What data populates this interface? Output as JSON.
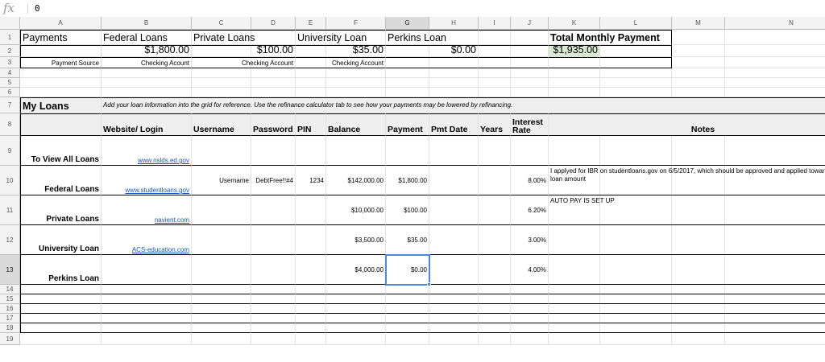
{
  "formula_bar": {
    "fx_label": "fx",
    "value": "0"
  },
  "columns": [
    "A",
    "B",
    "C",
    "D",
    "E",
    "F",
    "G",
    "H",
    "I",
    "J",
    "K",
    "L",
    "M",
    "N"
  ],
  "rows": [
    "1",
    "2",
    "3",
    "4",
    "5",
    "6",
    "7",
    "8",
    "9",
    "10",
    "11",
    "12",
    "13",
    "14",
    "15",
    "16",
    "17",
    "18",
    "19"
  ],
  "selected": {
    "column": "G",
    "row": "13"
  },
  "payments": {
    "title": "Payments",
    "headers": [
      "Federal Loans",
      "Private Loans",
      "University Loan",
      "Perkins Loan"
    ],
    "amounts": [
      "$1,800.00",
      "$100.00",
      "$35.00",
      "$0.00"
    ],
    "source_label": "Payment Source",
    "sources": [
      "Checking Acount",
      "Checking Account",
      "Checking Account"
    ],
    "total_label": "Total Monthly Payment",
    "total_value": "$1,935.00",
    "total_bg": "#d9ead3"
  },
  "my_loans": {
    "title": "My Loans",
    "note": "Add your loan information into the grid for reference.  Use the refinance calculator tab to see how your payments may be lowered by refinancing.",
    "headers": [
      "Website/ Login",
      "Username",
      "Password",
      "PIN",
      "Balance",
      "Payment",
      "Pmt Date",
      "Years",
      "Interest Rate",
      "Notes"
    ],
    "rows": [
      {
        "name": "To View All Loans",
        "website": "www.nslds.ed.gov",
        "username": "",
        "password": "",
        "pin": "",
        "balance": "",
        "payment": "",
        "pmt_date": "",
        "years": "",
        "rate": "",
        "notes": ""
      },
      {
        "name": "Federal Loans",
        "website": "www.studentloans.gov",
        "username": "Username",
        "password": "DebtFree!!#4",
        "pin": "1234",
        "balance": "$142,000.00",
        "payment": "$1,800.00",
        "pmt_date": "",
        "years": "",
        "rate": "8.00%",
        "notes": "I applyed for IBR on studentloans.gov on 6/5/2017, which should be approved and applied towards this loan amount"
      },
      {
        "name": "Private Loans",
        "website": "navient.com",
        "username": "",
        "password": "",
        "pin": "",
        "balance": "$10,000.00",
        "payment": "$100.00",
        "pmt_date": "",
        "years": "",
        "rate": "6.20%",
        "notes": "AUTO PAY IS SET UP"
      },
      {
        "name": "University Loan",
        "website": "ACS-education.com",
        "username": "",
        "password": "",
        "pin": "",
        "balance": "$3,500.00",
        "payment": "$35.00",
        "pmt_date": "",
        "years": "",
        "rate": "3.00%",
        "notes": ""
      },
      {
        "name": "Perkins Loan",
        "website": "",
        "username": "",
        "password": "",
        "pin": "",
        "balance": "$4,000.00",
        "payment": "$0.00",
        "pmt_date": "",
        "years": "",
        "rate": "4.00%",
        "notes": ""
      }
    ]
  },
  "colors": {
    "link": "#1155cc",
    "header_bg": "#f3f3f3",
    "section_bg": "#efefef",
    "selection": "#4a86e8"
  }
}
